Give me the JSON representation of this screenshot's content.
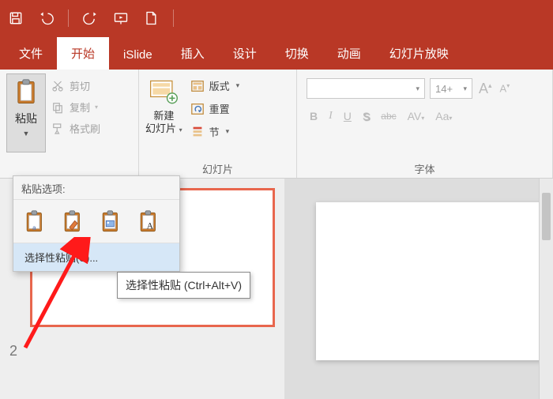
{
  "quickaccess": {
    "save_title": "保存",
    "undo_title": "撤销",
    "redo_title": "重复",
    "from_beginning_title": "从头开始",
    "new_title": "新建"
  },
  "tabs": {
    "file": "文件",
    "home": "开始",
    "islide": "iSlide",
    "insert": "插入",
    "design": "设计",
    "transitions": "切换",
    "animations": "动画",
    "slideshow": "幻灯片放映"
  },
  "clipboard": {
    "paste": "粘贴",
    "cut": "剪切",
    "copy": "复制",
    "format_painter": "格式刷"
  },
  "slides": {
    "new_slide_line1": "新建",
    "new_slide_line2": "幻灯片",
    "layout": "版式",
    "reset": "重置",
    "section": "节",
    "group_title": "幻灯片"
  },
  "font": {
    "name_placeholder": "",
    "size_value": "14+",
    "group_title": "字体",
    "bold": "B",
    "italic": "I",
    "underline": "U",
    "shadow": "S",
    "strike": "abc",
    "spacing": "AV",
    "case": "Aa"
  },
  "paste_popup": {
    "header": "粘贴选项:",
    "special": "选择性粘贴(S)..."
  },
  "tooltip": {
    "text": "选择性粘贴 (Ctrl+Alt+V)"
  },
  "thumbs": {
    "n1": "",
    "n2": "2"
  }
}
